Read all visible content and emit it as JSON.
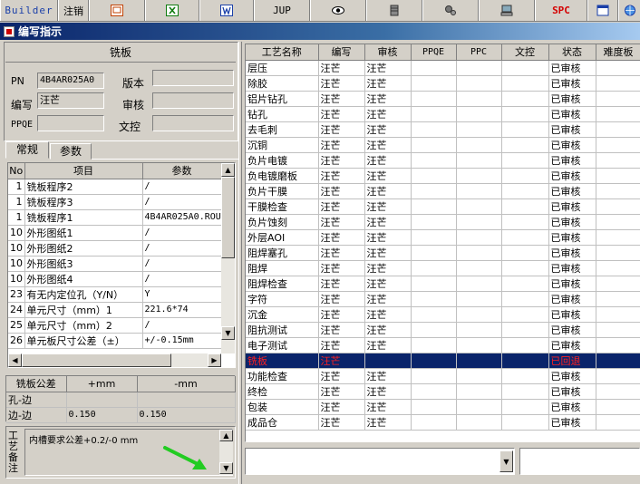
{
  "toolbar": {
    "builder": "Builder",
    "logout": "注销",
    "jup": "JUP",
    "spc": "SPC"
  },
  "window": {
    "title": "编写指示"
  },
  "info": {
    "title": "铣板",
    "pn_label": "PN",
    "pn_value": "4B4AR025A0",
    "version_label": "版本",
    "version_value": "",
    "writer_label": "编写",
    "writer_value": "汪芒",
    "review_label": "审核",
    "review_value": "",
    "ppqe_label": "PPQE",
    "ppqe_value": "",
    "doc_label": "文控",
    "doc_value": ""
  },
  "tabs": [
    "常规",
    "参数"
  ],
  "params": {
    "headers": [
      "No",
      "项目",
      "参数"
    ],
    "rows": [
      [
        "1",
        "铣板程序2",
        "/"
      ],
      [
        "1",
        "铣板程序3",
        "/"
      ],
      [
        "1",
        "铣板程序1",
        "4B4AR025A0.ROU"
      ],
      [
        "10",
        "外形图纸1",
        "/"
      ],
      [
        "10",
        "外形图纸2",
        "/"
      ],
      [
        "10",
        "外形图纸3",
        "/"
      ],
      [
        "10",
        "外形图纸4",
        "/"
      ],
      [
        "23",
        "有无内定位孔（Y/N）",
        "Y"
      ],
      [
        "24",
        "单元尺寸（mm）1",
        "221.6*74"
      ],
      [
        "25",
        "单元尺寸（mm）2",
        "/"
      ],
      [
        "26",
        "单元板尺寸公差（±）",
        "+/-0.15mm"
      ]
    ]
  },
  "tolerance": {
    "headers": [
      "铣板公差",
      "+mm",
      "-mm"
    ],
    "rows": [
      [
        "孔-边",
        "",
        ""
      ],
      [
        "边-边",
        "0.150",
        "0.150"
      ]
    ]
  },
  "remarks": {
    "label": "工艺备注",
    "text": "内槽要求公差+0.2/-0 mm"
  },
  "process": {
    "headers": [
      "工艺名称",
      "编写",
      "审核",
      "PPQE",
      "PPC",
      "文控",
      "状态",
      "难度板"
    ],
    "rows": [
      [
        "层压",
        "汪芒",
        "汪芒",
        "",
        "",
        "",
        "已审核",
        ""
      ],
      [
        "除胶",
        "汪芒",
        "汪芒",
        "",
        "",
        "",
        "已审核",
        ""
      ],
      [
        "铝片钻孔",
        "汪芒",
        "汪芒",
        "",
        "",
        "",
        "已审核",
        ""
      ],
      [
        "钻孔",
        "汪芒",
        "汪芒",
        "",
        "",
        "",
        "已审核",
        ""
      ],
      [
        "去毛刺",
        "汪芒",
        "汪芒",
        "",
        "",
        "",
        "已审核",
        ""
      ],
      [
        "沉铜",
        "汪芒",
        "汪芒",
        "",
        "",
        "",
        "已审核",
        ""
      ],
      [
        "负片电镀",
        "汪芒",
        "汪芒",
        "",
        "",
        "",
        "已审核",
        ""
      ],
      [
        "负电镀磨板",
        "汪芒",
        "汪芒",
        "",
        "",
        "",
        "已审核",
        ""
      ],
      [
        "负片干膜",
        "汪芒",
        "汪芒",
        "",
        "",
        "",
        "已审核",
        ""
      ],
      [
        "干膜检查",
        "汪芒",
        "汪芒",
        "",
        "",
        "",
        "已审核",
        ""
      ],
      [
        "负片蚀刻",
        "汪芒",
        "汪芒",
        "",
        "",
        "",
        "已审核",
        ""
      ],
      [
        "外层AOI",
        "汪芒",
        "汪芒",
        "",
        "",
        "",
        "已审核",
        ""
      ],
      [
        "阻焊塞孔",
        "汪芒",
        "汪芒",
        "",
        "",
        "",
        "已审核",
        ""
      ],
      [
        "阻焊",
        "汪芒",
        "汪芒",
        "",
        "",
        "",
        "已审核",
        ""
      ],
      [
        "阻焊检查",
        "汪芒",
        "汪芒",
        "",
        "",
        "",
        "已审核",
        ""
      ],
      [
        "字符",
        "汪芒",
        "汪芒",
        "",
        "",
        "",
        "已审核",
        ""
      ],
      [
        "沉金",
        "汪芒",
        "汪芒",
        "",
        "",
        "",
        "已审核",
        ""
      ],
      [
        "阻抗测试",
        "汪芒",
        "汪芒",
        "",
        "",
        "",
        "已审核",
        ""
      ],
      [
        "电子测试",
        "汪芒",
        "汪芒",
        "",
        "",
        "",
        "已审核",
        ""
      ],
      [
        "铣板",
        "汪芒",
        "",
        "",
        "",
        "",
        "已回退",
        ""
      ],
      [
        "功能检查",
        "汪芒",
        "汪芒",
        "",
        "",
        "",
        "已审核",
        ""
      ],
      [
        "终检",
        "汪芒",
        "汪芒",
        "",
        "",
        "",
        "已审核",
        ""
      ],
      [
        "包装",
        "汪芒",
        "汪芒",
        "",
        "",
        "",
        "已审核",
        ""
      ],
      [
        "成品仓",
        "汪芒",
        "汪芒",
        "",
        "",
        "",
        "已审核",
        ""
      ]
    ],
    "selected_index": 19
  },
  "colors": {
    "selection": "#0a246a",
    "reject": "#ff2020",
    "arrow": "#22cc22"
  }
}
